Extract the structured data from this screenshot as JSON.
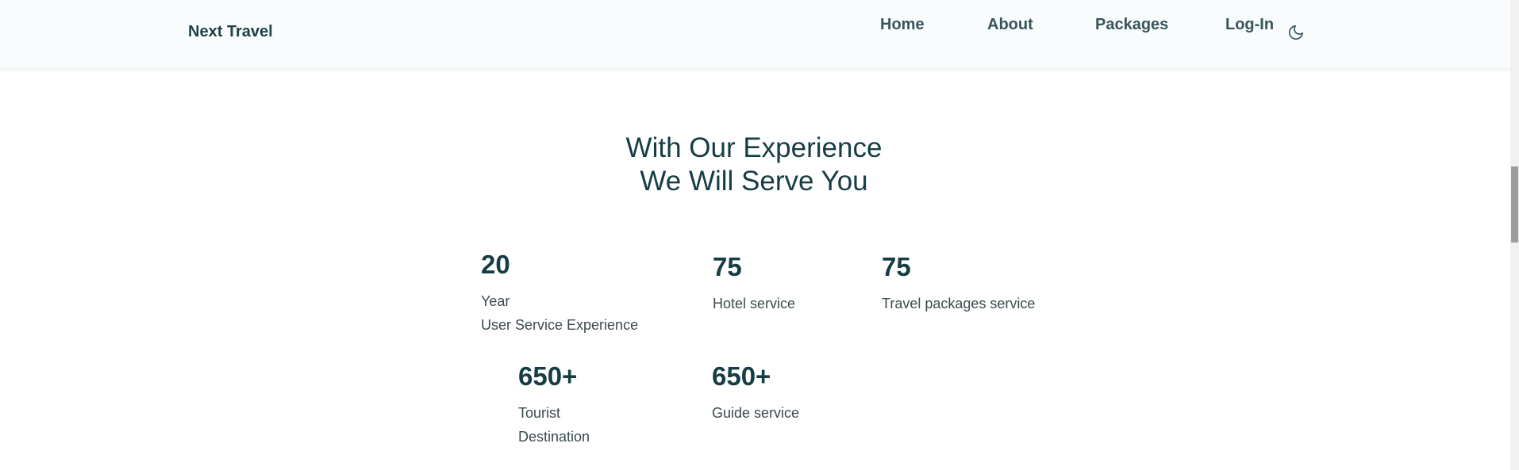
{
  "header": {
    "logo": "Next Travel",
    "nav": [
      "Home",
      "About",
      "Packages",
      "Log-In"
    ],
    "theme_toggle_icon": "moon-icon"
  },
  "section": {
    "title_lines": [
      "With Our Experience",
      "We Will Serve You"
    ],
    "stats": [
      {
        "value": "20",
        "label_lines": [
          "Year",
          "User Service Experience"
        ]
      },
      {
        "value": "75",
        "label_lines": [
          "Hotel service"
        ]
      },
      {
        "value": "75",
        "label_lines": [
          "Travel packages service"
        ]
      },
      {
        "value": "650+",
        "label_lines": [
          "Tourist",
          "Destination"
        ]
      },
      {
        "value": "650+",
        "label_lines": [
          "Guide service"
        ]
      }
    ]
  },
  "colors": {
    "header_bg": "#f8fcfc",
    "heading": "#163d44",
    "text": "#3b4a4d"
  }
}
